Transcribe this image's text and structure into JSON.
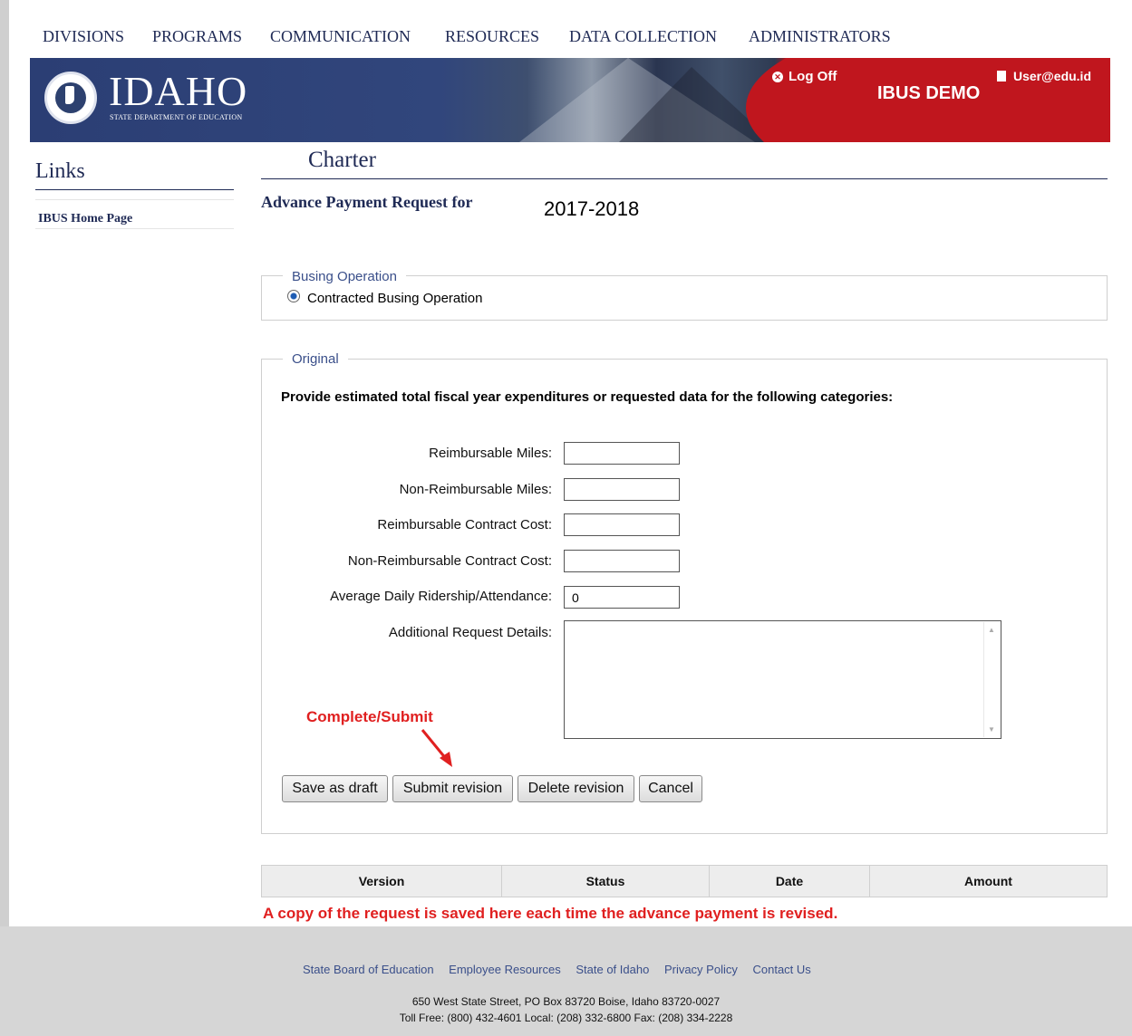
{
  "nav": [
    "DIVISIONS",
    "PROGRAMS",
    "COMMUNICATION",
    "RESOURCES",
    "DATA COLLECTION",
    "ADMINISTRATORS"
  ],
  "header": {
    "logo_text": "IDAHO",
    "logo_sub": "STATE DEPARTMENT OF EDUCATION",
    "logoff": "Log Off",
    "app_name": "IBUS DEMO",
    "user": "User@edu.id"
  },
  "sidebar": {
    "title": "Links",
    "items": [
      "IBUS Home Page"
    ]
  },
  "main": {
    "section_title": "Charter",
    "request_label": "Advance Payment Request for",
    "year": "2017-2018",
    "busing": {
      "legend": "Busing Operation",
      "option": "Contracted Busing Operation"
    },
    "original": {
      "legend": "Original",
      "instructions": "Provide estimated total fiscal year expenditures or requested data for the following categories:",
      "fields": [
        {
          "label": "Reimbursable Miles:",
          "value": ""
        },
        {
          "label": "Non-Reimbursable Miles:",
          "value": ""
        },
        {
          "label": "Reimbursable Contract Cost:",
          "value": ""
        },
        {
          "label": "Non-Reimbursable Contract Cost:",
          "value": ""
        },
        {
          "label": "Average Daily Ridership/Attendance:",
          "value": "0"
        }
      ],
      "details_label": "Additional Request Details:",
      "annotation": "Complete/Submit",
      "buttons": {
        "save": "Save as draft",
        "submit": "Submit revision",
        "delete": "Delete revision",
        "cancel": "Cancel"
      }
    },
    "table": {
      "headers": [
        "Version",
        "Status",
        "Date",
        "Amount"
      ]
    },
    "table_annotation": "A copy of the request is saved here each time the advance payment is revised."
  },
  "footer": {
    "links": [
      "State Board of Education",
      "Employee Resources",
      "State of Idaho",
      "Privacy Policy",
      "Contact Us"
    ],
    "address": "650 West State Street, PO Box 83720 Boise, Idaho 83720-0027",
    "phones": "Toll Free: (800) 432-4601 Local: (208) 332-6800 Fax: (208) 334-2228"
  },
  "colors": {
    "nav_text": "#1f2a55",
    "banner_blue": "#2b3e74",
    "banner_red": "#c0161e",
    "annotation_red": "#e02020",
    "link_blue": "#3a4f8a"
  }
}
